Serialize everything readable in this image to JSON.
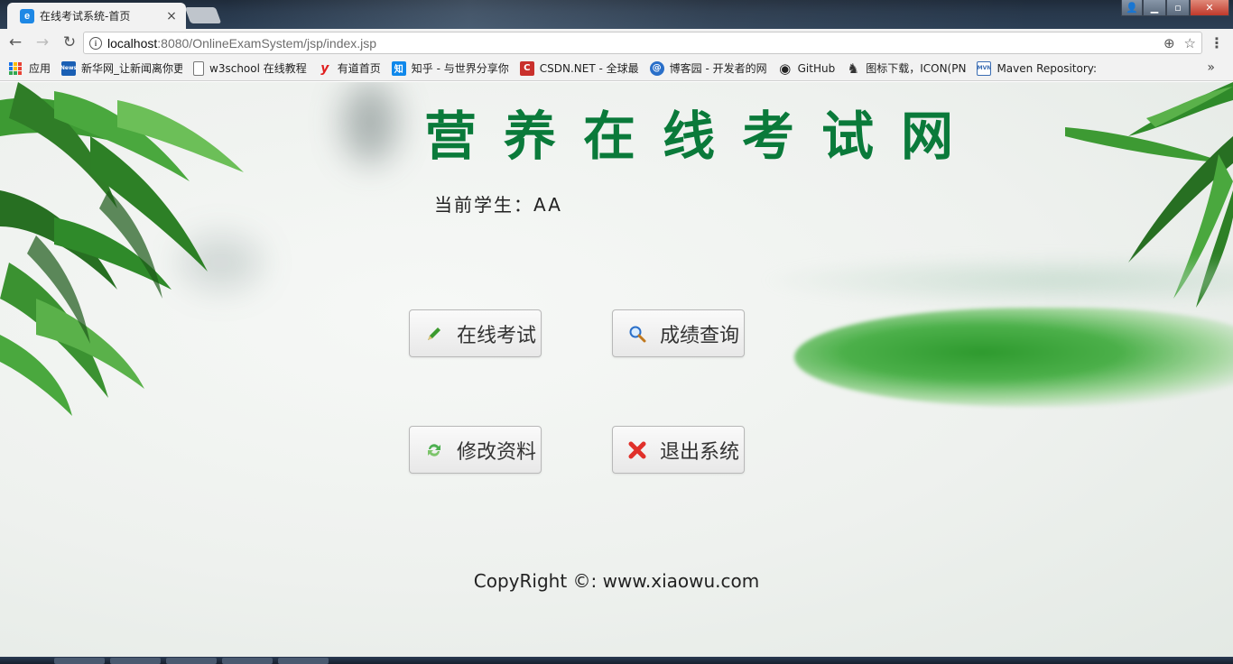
{
  "window": {
    "tab_title": "在线考试系统-首页",
    "tab_favicon": "e",
    "close_glyph": "×",
    "controls": {
      "user": "👤",
      "minimize": "▁",
      "maximize": "▫",
      "close": "✕"
    }
  },
  "toolbar": {
    "url_host": "localhost",
    "url_path": ":8080/OnlineExamSystem/jsp/index.jsp",
    "icons": {
      "back": "←",
      "forward": "→",
      "reload": "↻",
      "info": "i",
      "zoom": "⊕",
      "star": "☆",
      "menu": "⋮"
    }
  },
  "bookmarks": {
    "apps_label": "应用",
    "items": [
      {
        "label": "新华网_让新闻离你更",
        "icon": "News",
        "color": "#1a5fb4"
      },
      {
        "label": "w3school 在线教程",
        "icon": "",
        "color": "#ffffff"
      },
      {
        "label": "有道首页",
        "icon": "y",
        "color": "#e02020"
      },
      {
        "label": "知乎 - 与世界分享你",
        "icon": "知",
        "color": "#0f88eb"
      },
      {
        "label": "CSDN.NET - 全球最",
        "icon": "C",
        "color": "#c9302c"
      },
      {
        "label": "博客园 - 开发者的网",
        "icon": "@",
        "color": "#2a6fc9"
      },
      {
        "label": "GitHub",
        "icon": "◉",
        "color": "#222222"
      },
      {
        "label": "图标下载，ICON(PN",
        "icon": "♞",
        "color": "#333333"
      },
      {
        "label": "Maven Repository:",
        "icon": "MVN",
        "color": "#3b6db3"
      }
    ],
    "more": "»"
  },
  "page": {
    "title": "营养在线考试网",
    "student_label": "当前学生：AA",
    "buttons": {
      "exam": "在线考试",
      "score": "成绩查询",
      "profile": "修改资料",
      "logout": "退出系统"
    },
    "copyright": "CopyRight ©: www.xiaowu.com"
  },
  "colors": {
    "title": "#0a7a3a",
    "accent_green": "#2e9a2e"
  }
}
